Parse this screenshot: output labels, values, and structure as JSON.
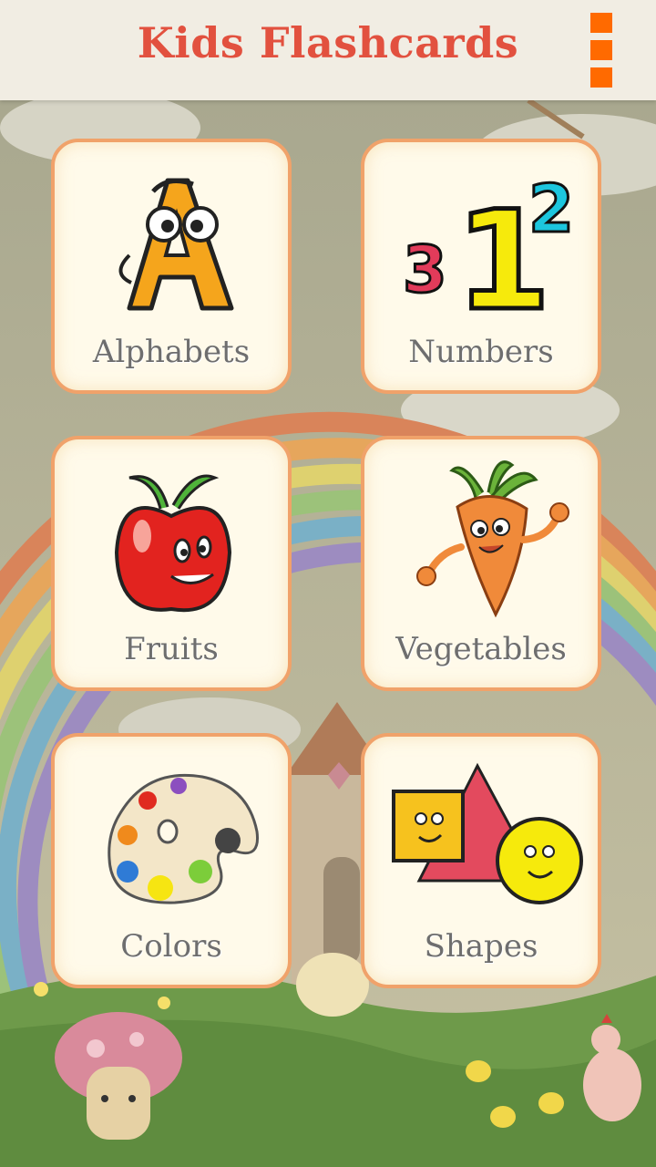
{
  "app": {
    "title": "Kids Flashcards",
    "menu_icon": "overflow-menu-icon",
    "accent": "#e2513f",
    "menu_color": "#ff6a00"
  },
  "categories": [
    {
      "label": "Alphabets",
      "icon": "letter-a-icon"
    },
    {
      "label": "Numbers",
      "icon": "numbers-icon"
    },
    {
      "label": "Fruits",
      "icon": "apple-icon"
    },
    {
      "label": "Vegetables",
      "icon": "carrot-icon"
    },
    {
      "label": "Colors",
      "icon": "paint-palette-icon"
    },
    {
      "label": "Shapes",
      "icon": "shapes-icon"
    }
  ],
  "numbers_art": {
    "small": "3",
    "big": "1",
    "superscript": "2"
  }
}
